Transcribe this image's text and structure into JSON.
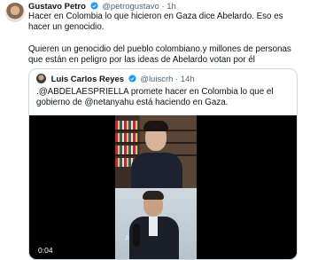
{
  "tweet": {
    "author_name": "Gustavo Petro",
    "handle": "@petrogustavo",
    "separator": "·",
    "time": "1h",
    "paragraph1": "Hacer en Colombia lo que hicieron en Gaza dice Abelardo. Eso es hacer un genocidio.",
    "paragraph2": "Quieren un genocidio del pueblo colombiano.y millones de personas que están en peligro por las ideas de Abelardo votan por él"
  },
  "quoted": {
    "author_name": "Luis Carlos Reyes",
    "handle": "@luiscrh",
    "separator": "·",
    "time": "14h",
    "text": ".@ABDELAESPRIELLA promete hacer en Colombia lo que el gobierno de @netanyahu está haciendo en Gaza.",
    "video_time": "0:04",
    "watermark": "♪"
  },
  "colors": {
    "verified": "#1d9bf0",
    "muted": "#536471",
    "border": "#cfd9de"
  },
  "icons": [
    "verified-badge-icon",
    "tiktok-icon"
  ]
}
